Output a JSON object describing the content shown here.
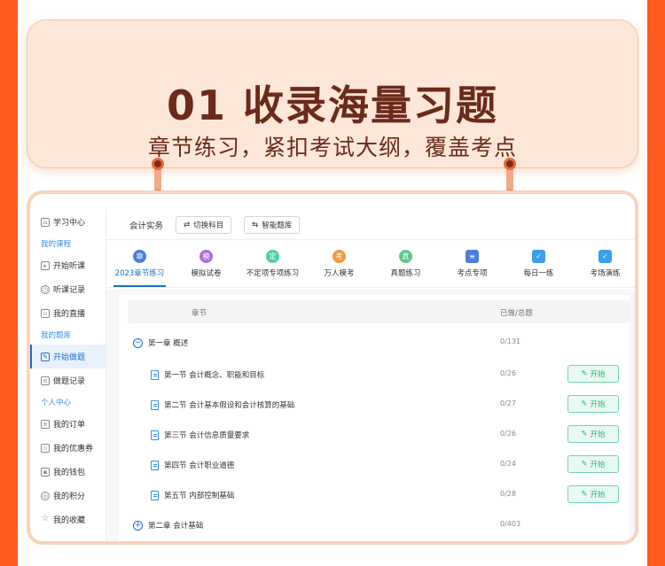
{
  "banner": {
    "title": "01 收录海量习题",
    "subtitle": "章节练习，紧扣考试大纲，覆盖考点"
  },
  "sidebar": {
    "items": [
      {
        "label": "学习中心",
        "icon": "home-icon",
        "type": "item"
      },
      {
        "label": "我的课程",
        "type": "section"
      },
      {
        "label": "开始听课",
        "icon": "play-icon",
        "type": "item"
      },
      {
        "label": "听课记录",
        "icon": "history-icon",
        "type": "item"
      },
      {
        "label": "我的直播",
        "icon": "calendar-icon",
        "type": "item"
      },
      {
        "label": "我的题库",
        "type": "section"
      },
      {
        "label": "开始做题",
        "icon": "edit-icon",
        "type": "item",
        "active": true
      },
      {
        "label": "做题记录",
        "icon": "record-icon",
        "type": "item"
      },
      {
        "label": "个人中心",
        "type": "section"
      },
      {
        "label": "我的订单",
        "icon": "order-icon",
        "type": "item"
      },
      {
        "label": "我的优惠券",
        "icon": "coupon-icon",
        "type": "item"
      },
      {
        "label": "我的钱包",
        "icon": "wallet-icon",
        "type": "item"
      },
      {
        "label": "我的积分",
        "icon": "points-icon",
        "type": "item"
      },
      {
        "label": "我的收藏",
        "icon": "star-icon",
        "type": "item"
      }
    ]
  },
  "topbar": {
    "subject": "会计实务",
    "switch_label": "切换科目",
    "smart_label": "智能题库"
  },
  "tabs": [
    {
      "label": "2023章节练习",
      "glyph": "章",
      "color": "#4a7fe0",
      "active": true
    },
    {
      "label": "模拟试卷",
      "glyph": "模",
      "color": "#b26be0"
    },
    {
      "label": "不定项专项练习",
      "glyph": "定",
      "color": "#4fcf9a"
    },
    {
      "label": "万人模考",
      "glyph": "考",
      "color": "#f29b3a"
    },
    {
      "label": "真题练习",
      "glyph": "真",
      "color": "#5cc98a"
    },
    {
      "label": "考点专项",
      "glyph": "≡",
      "color": "#4a7fe0",
      "square": true
    },
    {
      "label": "每日一练",
      "glyph": "✓",
      "color": "#3aa0e8",
      "square": true
    },
    {
      "label": "考场演练",
      "glyph": "✓",
      "color": "#3aa0e8",
      "square": true
    }
  ],
  "table": {
    "col_chapter": "章节",
    "col_progress": "已做/总题",
    "start_label": "开始",
    "chapters": [
      {
        "label": "第一章 概述",
        "count": "0/131",
        "expanded": true
      },
      {
        "label": "第二章 会计基础",
        "count": "0/403",
        "expanded": false
      }
    ],
    "sections": [
      {
        "label": "第一节 会计概念、职能和目标",
        "count": "0/26"
      },
      {
        "label": "第二节 会计基本假设和会计核算的基础",
        "count": "0/27"
      },
      {
        "label": "第三节 会计信息质量要求",
        "count": "0/26"
      },
      {
        "label": "第四节 会计职业道德",
        "count": "0/24"
      },
      {
        "label": "第五节 内部控制基础",
        "count": "0/28"
      }
    ]
  }
}
